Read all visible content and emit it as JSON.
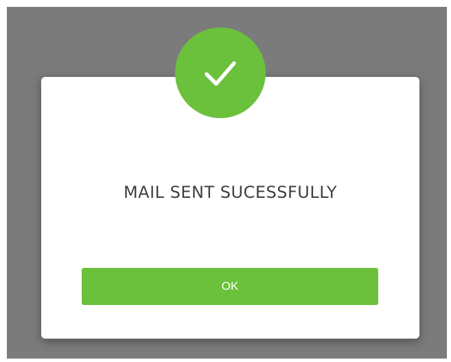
{
  "dialog": {
    "icon": "checkmark-icon",
    "message": "MAIL SENT SUCESSFULLY",
    "ok_label": "OK"
  },
  "colors": {
    "overlay": "#7b7b7b",
    "accent": "#6cc13c",
    "message_text": "#3f3f3f",
    "button_text": "#ffffff"
  }
}
